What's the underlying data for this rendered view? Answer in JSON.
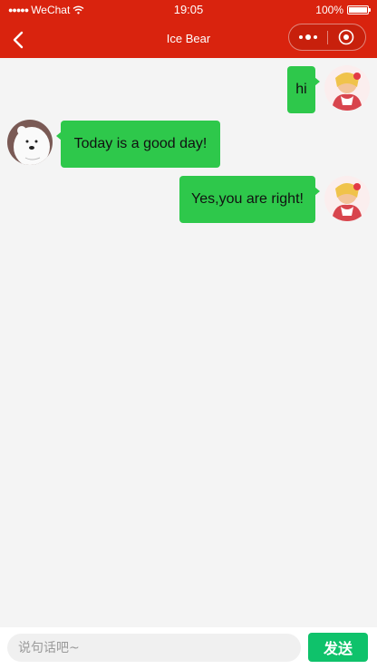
{
  "status_bar": {
    "carrier": "WeChat",
    "time": "19:05",
    "battery": "100%"
  },
  "nav": {
    "title": "Ice Bear",
    "icons": {
      "back": "chevron-left-icon",
      "more": "more-dots-icon",
      "close": "target-circle-icon"
    }
  },
  "colors": {
    "header": "#d9230e",
    "bubble": "#2ec84b",
    "send_button": "#0fc26b",
    "background": "#f4f4f4"
  },
  "messages": [
    {
      "side": "right",
      "sender": "user",
      "text": "hi"
    },
    {
      "side": "left",
      "sender": "Ice Bear",
      "text": "Today is a good day!"
    },
    {
      "side": "right",
      "sender": "user",
      "text": "Yes,you are right!"
    }
  ],
  "composer": {
    "placeholder": "说句话吧~",
    "send_label": "发送"
  }
}
